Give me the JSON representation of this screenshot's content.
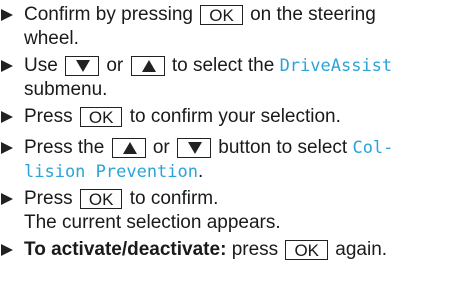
{
  "steps": [
    {
      "a": "Confirm by pressing",
      "key": "OK",
      "b": "on the steering",
      "c": "wheel."
    },
    {
      "a": "Use",
      "or": "or",
      "b": "to select the",
      "menu": "DriveAssist",
      "c": "submenu."
    },
    {
      "a": "Press",
      "key": "OK",
      "b": "to confirm your selection."
    },
    {
      "a": "Press the",
      "or": "or",
      "b": "button to select",
      "menu1": "Col-",
      "menu2": "lision Prevention",
      "end": "."
    },
    {
      "a": "Press",
      "key": "OK",
      "b": "to confirm.",
      "c": "The current selection appears."
    },
    {
      "label": "To activate/deactivate:",
      "a": "press",
      "key": "OK",
      "b": "again."
    }
  ],
  "icons": {
    "bullet": "triangle-right-icon",
    "down": "down-triangle-icon",
    "up": "up-triangle-icon"
  }
}
